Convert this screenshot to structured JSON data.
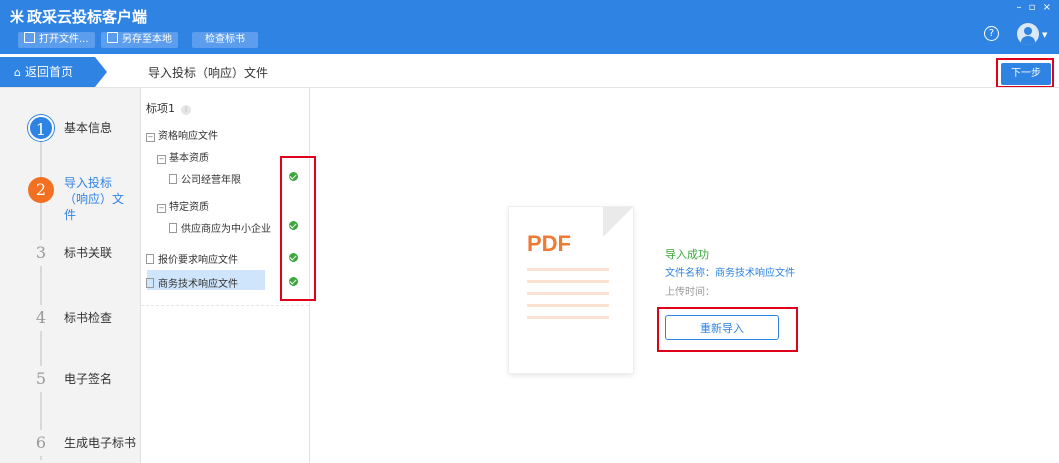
{
  "app": {
    "title": "政采云投标客户端",
    "logo": "米"
  },
  "toolbar": {
    "open_label": "打开文件...",
    "save_label": "另存至本地",
    "check_label": "检查标书"
  },
  "window": {
    "controls": "– ▫ ×"
  },
  "header": {
    "help_glyph": "?",
    "back_label": "返回首页",
    "page_title": "导入投标（响应）文件",
    "next_label": "下一步"
  },
  "steps": [
    {
      "num": "1",
      "label": "基本信息",
      "state": "done"
    },
    {
      "num": "2",
      "label": "导入投标（响应）文件",
      "state": "active"
    },
    {
      "num": "3",
      "label": "标书关联",
      "state": "todo"
    },
    {
      "num": "4",
      "label": "标书检查",
      "state": "todo"
    },
    {
      "num": "5",
      "label": "电子签名",
      "state": "todo"
    },
    {
      "num": "6",
      "label": "生成电子标书",
      "state": "todo"
    }
  ],
  "tree": {
    "section": "标项1",
    "info_glyph": "i",
    "nodes": [
      {
        "label": "资格响应文件",
        "kind": "folder",
        "checked": false
      },
      {
        "label": "基本资质",
        "kind": "folder",
        "checked": false
      },
      {
        "label": "公司经营年限",
        "kind": "file",
        "checked": true
      },
      {
        "label": "特定资质",
        "kind": "folder",
        "checked": false
      },
      {
        "label": "供应商应为中小企业",
        "kind": "file",
        "checked": true
      },
      {
        "label": "报价要求响应文件",
        "kind": "file",
        "checked": true
      },
      {
        "label": "商务技术响应文件",
        "kind": "file",
        "checked": true,
        "selected": true
      }
    ]
  },
  "preview": {
    "pdf_label": "PDF",
    "status": "导入成功",
    "file_name_line": "文件名称：商务技术响应文件",
    "upload_time_line": "上传时间：",
    "reimport_label": "重新导入"
  },
  "colors": {
    "primary": "#2f83e3",
    "active_step": "#f27022",
    "success": "#3aa83a",
    "highlight_frame": "#e0001b"
  }
}
